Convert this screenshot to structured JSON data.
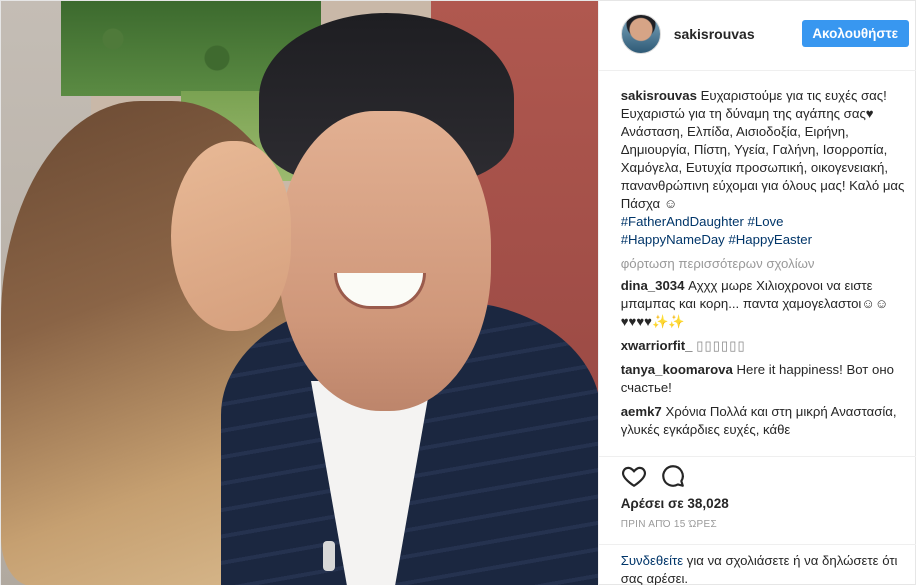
{
  "header": {
    "username": "sakisrouvas",
    "follow_label": "Ακολουθήστε"
  },
  "caption": {
    "username": "sakisrouvas",
    "text": "Ευχαριστούμε για τις ευχές σας! Ευχαριστώ για τη δύναμη της αγάπης σας♥ Ανάσταση, Ελπίδα, Αισιοδοξία, Ειρήνη, Δημιουργία, Πίστη, Υγεία, Γαλήνη, Ισορροπία, Χαμόγελα, Ευτυχία προσωπική, οικογενειακή, πανανθρώπινη εύχομαι για όλους μας! Καλό μας Πάσχα ☺",
    "hashtags": [
      "#FatherAndDaughter",
      "#Love",
      "#HappyNameDay",
      "#HappyEaster"
    ]
  },
  "load_more_label": "φόρτωση περισσότερων σχολίων",
  "comments": [
    {
      "username": "dina_3034",
      "text": "Αχχχ μωρε Χιλιοχρονοι να ειστε μπαμπας και κορη... παντα χαμογελαστοι☺☺♥♥♥♥✨✨"
    },
    {
      "username": "xwarriorfit_",
      "text": "▯▯▯▯▯▯"
    },
    {
      "username": "tanya_koomarova",
      "text": "Here it happiness! Вот оно счастье!"
    },
    {
      "username": "aemk7",
      "text": "Χρόνια Πολλά και στη μικρή Αναστασία, γλυκές εγκάρδιες ευχές, κάθε"
    }
  ],
  "icons": {
    "like": "heart-icon",
    "comment": "comment-icon"
  },
  "likes_label": "Αρέσει σε 38,028",
  "timestamp": "ΠΡΙΝ ΑΠΌ 15 ΏΡΕΣ",
  "login_prompt": {
    "link": "Συνδεθείτε",
    "text": " για να σχολιάσετε ή να δηλώσετε ότι σας αρέσει."
  },
  "colors": {
    "accent": "#3897f0",
    "link": "#003569",
    "muted": "#999999"
  }
}
